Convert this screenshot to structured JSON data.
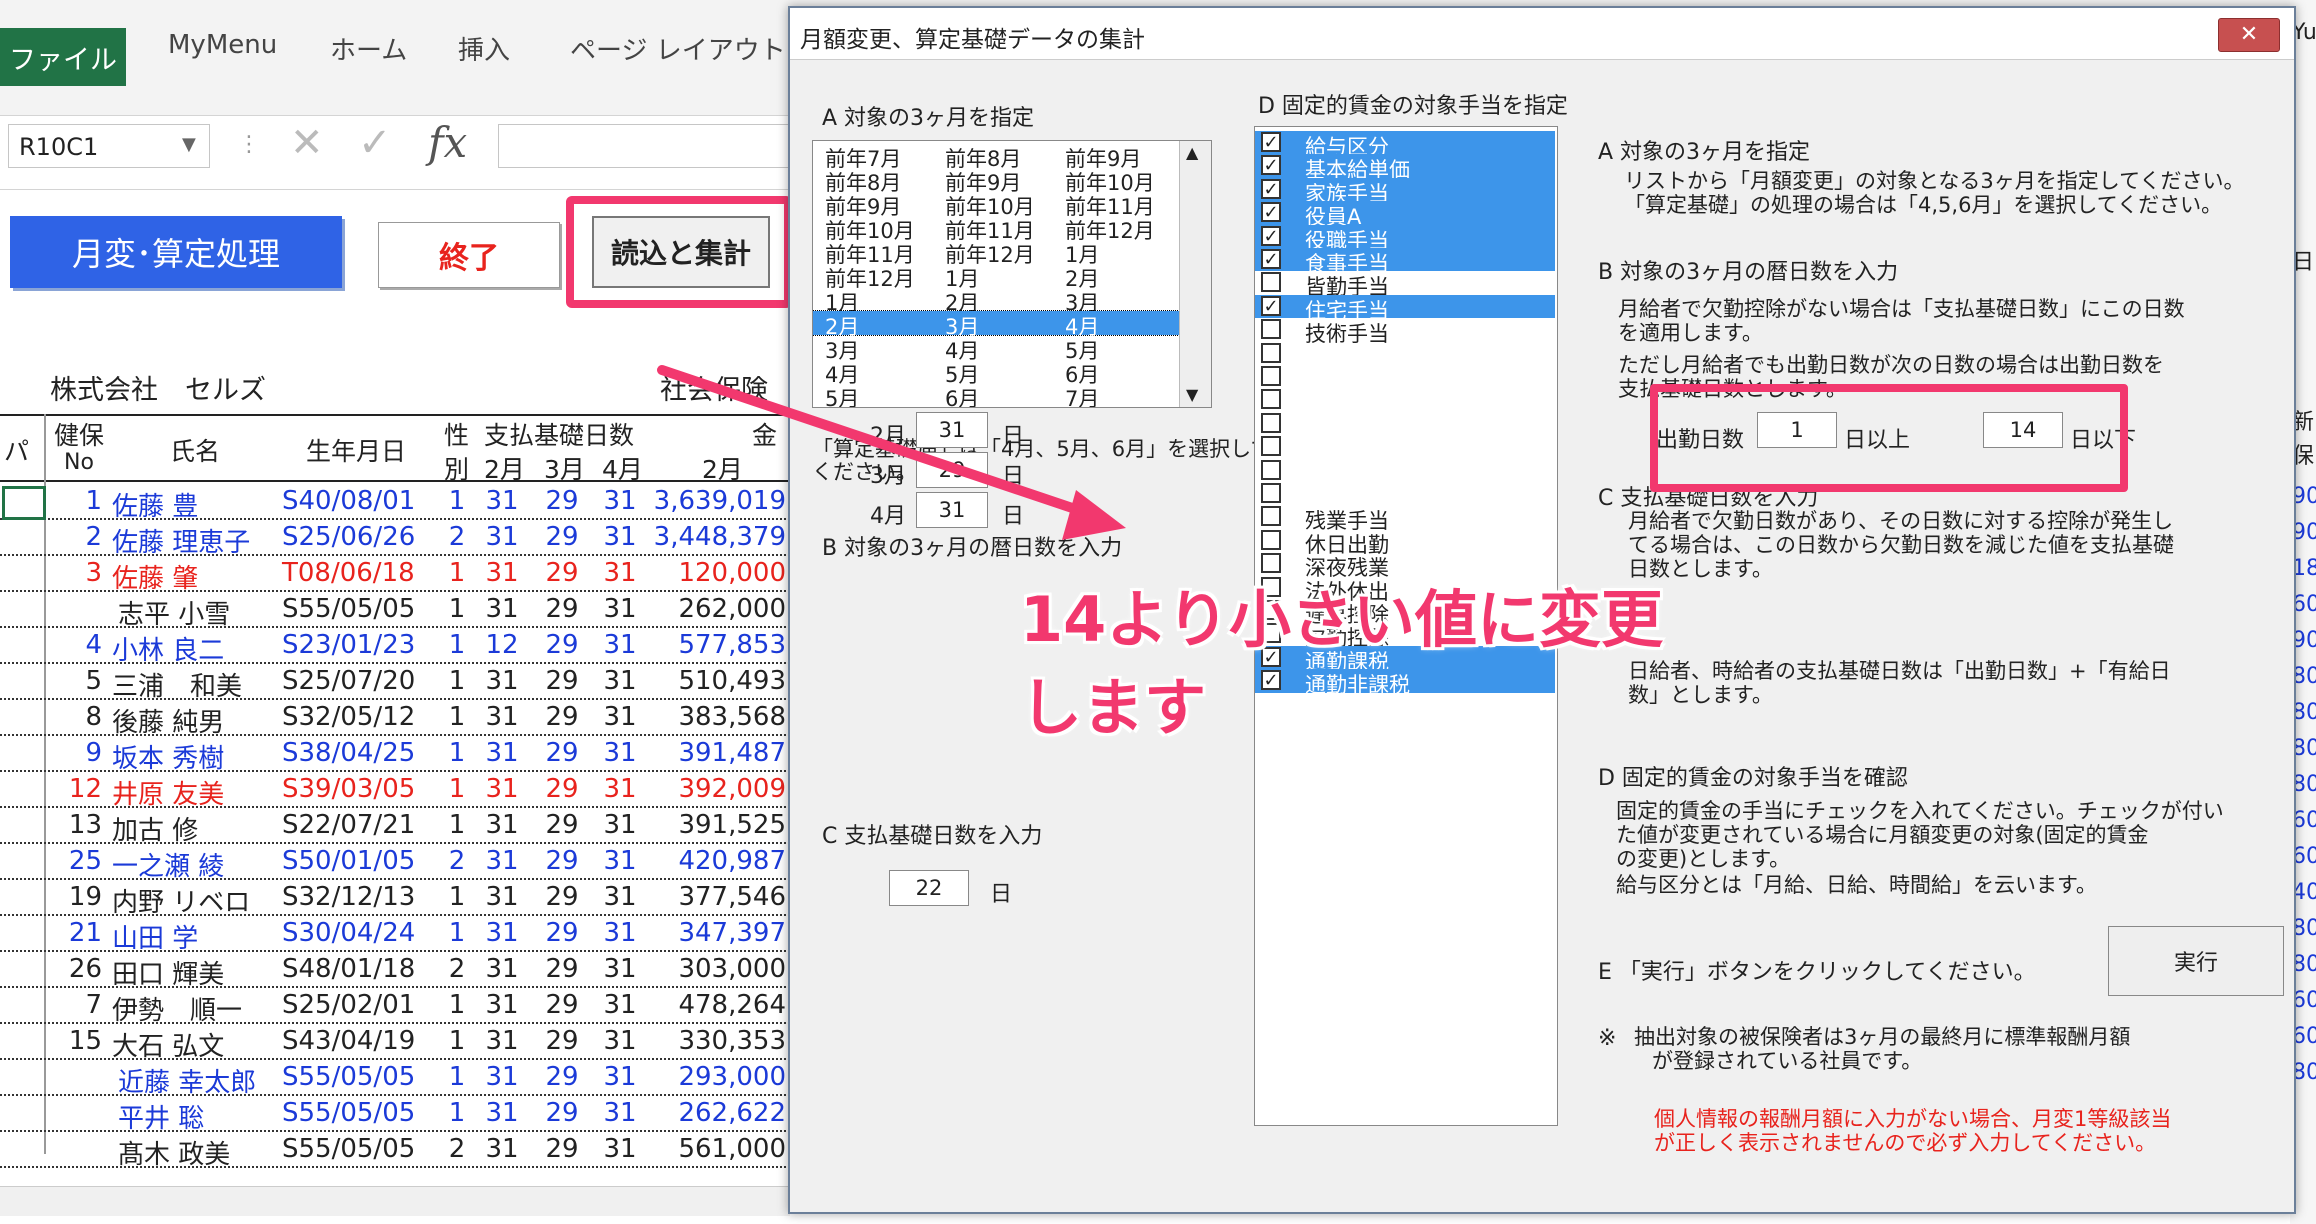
{
  "ribbon": {
    "tabs": [
      "ファイル",
      "MyMenu",
      "ホーム",
      "挿入",
      "ページ レイアウト"
    ]
  },
  "formula_bar": {
    "name_box": "R10C1",
    "fx": "fx"
  },
  "sheet": {
    "buttons": {
      "main": "月変･算定処理",
      "end": "終了",
      "read": "読込と集計"
    },
    "company": "株式会社　セルズ",
    "insurance_label": "社会保険",
    "headers": {
      "pa": "パ",
      "kenpo": "健保",
      "no": "No",
      "name": "氏名",
      "birth": "生年月日",
      "sex1": "性",
      "sex2": "別",
      "days_title": "支払基礎日数",
      "m2": "2月",
      "m3": "3月",
      "m4": "4月",
      "kin": "金",
      "amt2": "2月"
    },
    "rows": [
      {
        "no": "1",
        "name": "佐藤 豊",
        "birth": "S40/08/01",
        "sex": "1",
        "d2": "31",
        "d3": "29",
        "d4": "31",
        "amount": "3,639,019",
        "color": "#1b3ad8"
      },
      {
        "no": "2",
        "name": "佐藤 理恵子",
        "birth": "S25/06/26",
        "sex": "2",
        "d2": "31",
        "d3": "29",
        "d4": "31",
        "amount": "3,448,379",
        "color": "#1b3ad8"
      },
      {
        "no": "3",
        "name": "佐藤 肇",
        "birth": "T08/06/18",
        "sex": "1",
        "d2": "31",
        "d3": "29",
        "d4": "31",
        "amount": "120,000",
        "color": "#e8231d"
      },
      {
        "no": "",
        "name": "志平 小雪",
        "birth": "S55/05/05",
        "sex": "1",
        "d2": "31",
        "d3": "29",
        "d4": "31",
        "amount": "262,000",
        "color": "#222222"
      },
      {
        "no": "4",
        "name": "小林 良二",
        "birth": "S23/01/23",
        "sex": "1",
        "d2": "12",
        "d3": "29",
        "d4": "31",
        "amount": "577,853",
        "color": "#1b3ad8"
      },
      {
        "no": "5",
        "name": "三浦　和美",
        "birth": "S25/07/20",
        "sex": "1",
        "d2": "31",
        "d3": "29",
        "d4": "31",
        "amount": "510,493",
        "color": "#222222"
      },
      {
        "no": "8",
        "name": "後藤 純男",
        "birth": "S32/05/12",
        "sex": "1",
        "d2": "31",
        "d3": "29",
        "d4": "31",
        "amount": "383,568",
        "color": "#222222"
      },
      {
        "no": "9",
        "name": "坂本 秀樹",
        "birth": "S38/04/25",
        "sex": "1",
        "d2": "31",
        "d3": "29",
        "d4": "31",
        "amount": "391,487",
        "color": "#1b3ad8"
      },
      {
        "no": "12",
        "name": "井原 友美",
        "birth": "S39/03/05",
        "sex": "1",
        "d2": "31",
        "d3": "29",
        "d4": "31",
        "amount": "392,009",
        "color": "#e8231d"
      },
      {
        "no": "13",
        "name": "加古 修",
        "birth": "S22/07/21",
        "sex": "1",
        "d2": "31",
        "d3": "29",
        "d4": "31",
        "amount": "391,525",
        "color": "#222222"
      },
      {
        "no": "25",
        "name": "一之瀬 綾",
        "birth": "S50/01/05",
        "sex": "2",
        "d2": "31",
        "d3": "29",
        "d4": "31",
        "amount": "420,987",
        "color": "#1b3ad8"
      },
      {
        "no": "19",
        "name": "内野 リベロ",
        "birth": "S32/12/13",
        "sex": "1",
        "d2": "31",
        "d3": "29",
        "d4": "31",
        "amount": "377,546",
        "color": "#222222"
      },
      {
        "no": "21",
        "name": "山田 学",
        "birth": "S30/04/24",
        "sex": "1",
        "d2": "31",
        "d3": "29",
        "d4": "31",
        "amount": "347,397",
        "color": "#1b3ad8"
      },
      {
        "no": "26",
        "name": "田口 輝美",
        "birth": "S48/01/18",
        "sex": "2",
        "d2": "31",
        "d3": "29",
        "d4": "31",
        "amount": "303,000",
        "color": "#222222"
      },
      {
        "no": "7",
        "name": "伊勢　順一",
        "birth": "S25/02/01",
        "sex": "1",
        "d2": "31",
        "d3": "29",
        "d4": "31",
        "amount": "478,264",
        "color": "#222222"
      },
      {
        "no": "15",
        "name": "大石 弘文",
        "birth": "S43/04/19",
        "sex": "1",
        "d2": "31",
        "d3": "29",
        "d4": "31",
        "amount": "330,353",
        "color": "#222222"
      },
      {
        "no": "",
        "name": "近藤 幸太郎",
        "birth": "S55/05/05",
        "sex": "1",
        "d2": "31",
        "d3": "29",
        "d4": "31",
        "amount": "293,000",
        "color": "#1b3ad8"
      },
      {
        "no": "",
        "name": "平井 聡",
        "birth": "S55/05/05",
        "sex": "1",
        "d2": "31",
        "d3": "29",
        "d4": "31",
        "amount": "262,622",
        "color": "#1b3ad8"
      },
      {
        "no": "",
        "name": "髙木 政美",
        "birth": "S55/05/05",
        "sex": "2",
        "d2": "31",
        "d3": "29",
        "d4": "31",
        "amount": "561,000",
        "color": "#222222"
      }
    ],
    "right_edge": [
      "Yu",
      "日",
      "新",
      "保",
      "90",
      "90",
      "18",
      "60",
      "90",
      "80",
      "80",
      "80",
      "80",
      "60",
      "60",
      "40",
      "80",
      "80",
      "60",
      "60",
      "80"
    ]
  },
  "dialog": {
    "title": "月額変更、算定基礎データの集計",
    "close": "✕",
    "sec_a_label": "A 対象の3ヶ月を指定",
    "months": [
      [
        "前年7月",
        "前年8月",
        "前年9月"
      ],
      [
        "前年8月",
        "前年9月",
        "前年10月"
      ],
      [
        "前年9月",
        "前年10月",
        "前年11月"
      ],
      [
        "前年10月",
        "前年11月",
        "前年12月"
      ],
      [
        "前年11月",
        "前年12月",
        "1月"
      ],
      [
        "前年12月",
        "1月",
        "2月"
      ],
      [
        "1月",
        "2月",
        "3月"
      ],
      [
        "2月",
        "3月",
        "4月"
      ],
      [
        "3月",
        "4月",
        "5月"
      ],
      [
        "4月",
        "5月",
        "6月"
      ],
      [
        "5月",
        "6月",
        "7月"
      ]
    ],
    "selected_month_index": 7,
    "note_a_left": "「算定基礎届」は「4月、5月、6月」を選択してください。",
    "sec_b_label": "B 対象の3ヶ月の暦日数を入力",
    "b_rows": [
      {
        "label": "2月",
        "value": "31",
        "unit": "日"
      },
      {
        "label": "3月",
        "value": "29",
        "unit": "日"
      },
      {
        "label": "4月",
        "value": "31",
        "unit": "日"
      }
    ],
    "sec_c_label": "C 支払基礎日数を入力",
    "c_value": "22",
    "c_unit": "日",
    "sec_d_label": "D 固定的賃金の対象手当を指定",
    "allowances": [
      {
        "text": "給与区分",
        "checked": true,
        "selected": true
      },
      {
        "text": "基本給単価",
        "checked": true,
        "selected": true
      },
      {
        "text": "家族手当",
        "checked": true,
        "selected": true
      },
      {
        "text": "役員A",
        "checked": true,
        "selected": true
      },
      {
        "text": "役職手当",
        "checked": true,
        "selected": true
      },
      {
        "text": "食事手当",
        "checked": true,
        "selected": true
      },
      {
        "text": "皆勤手当",
        "checked": false,
        "selected": false
      },
      {
        "text": "住宅手当",
        "checked": true,
        "selected": true
      },
      {
        "text": "技術手当",
        "checked": false,
        "selected": false
      },
      {
        "text": "",
        "checked": false,
        "selected": false
      },
      {
        "text": "",
        "checked": false,
        "selected": false
      },
      {
        "text": "",
        "checked": false,
        "selected": false
      },
      {
        "text": "",
        "checked": false,
        "selected": false
      },
      {
        "text": "",
        "checked": false,
        "selected": false
      },
      {
        "text": "",
        "checked": false,
        "selected": false
      },
      {
        "text": "",
        "checked": false,
        "selected": false
      },
      {
        "text": "残業手当",
        "checked": false,
        "selected": false
      },
      {
        "text": "休日出勤",
        "checked": false,
        "selected": false
      },
      {
        "text": "深夜残業",
        "checked": false,
        "selected": false
      },
      {
        "text": "法外休出",
        "checked": false,
        "selected": false
      },
      {
        "text": "遅早控除",
        "checked": false,
        "selected": false
      },
      {
        "text": "欠勤控除",
        "checked": false,
        "selected": false
      },
      {
        "text": "通勤課税",
        "checked": true,
        "selected": true
      },
      {
        "text": "通勤非課税",
        "checked": true,
        "selected": true
      }
    ],
    "right": {
      "a_title": "A 対象の3ヶ月を指定",
      "a_note1": "リストから「月額変更」の対象となる3ヶ月を指定してください。",
      "a_note2": "「算定基礎」の処理の場合は「4,5,6月」を選択してください。",
      "b_title": "B 対象の3ヶ月の暦日数を入力",
      "b_note1": "月給者で欠勤控除がない場合は「支払基礎日数」にこの日数",
      "b_note2": "を適用します。",
      "b_note3": "ただし月給者でも出勤日数が次の日数の場合は出勤日数を",
      "b_note4": "支払基礎日数とします。",
      "days_label": "出勤日数",
      "days_from": "1",
      "days_from_unit": "日以上",
      "days_to": "14",
      "days_to_unit": "日以下",
      "c_title": "C 支払基礎日数を入力",
      "c_note1": "月給者で欠勤日数があり、その日数に対する控除が発生し",
      "c_note2": "てる場合は、この日数から欠勤日数を減じた値を支払基礎",
      "c_note3": "日数とします。",
      "c_note4": "日給者、時給者の支払基礎日数は「出勤日数」+「有給日",
      "c_note5": "数」とします。",
      "d_title": "D 固定的賃金の対象手当を確認",
      "d_note1": "固定的賃金の手当にチェックを入れてください。チェックが付い",
      "d_note2": "た値が変更されている場合に月額変更の対象(固定的賃金",
      "d_note3": "の変更)とします。",
      "d_note4": "給与区分とは「月給、日給、時間給」を云います。",
      "e_title": "E 「実行」ボタンをクリックしてください。",
      "exec": "実行",
      "asterisk": "※",
      "note_ast1": "抽出対象の被保険者は3ヶ月の最終月に標準報酬月額",
      "note_ast2": "が登録されている社員です。",
      "red1": "個人情報の報酬月額に入力がない場合、月変1等級該当",
      "red2": "が正しく表示されませんので必ず入力してください。"
    }
  },
  "annotation": {
    "line1": "14より小さい値に変更",
    "line2": "します"
  },
  "colors": {
    "accent": "#f2386e",
    "excel_green": "#217346",
    "selection_blue": "#3d95ea",
    "link_blue": "#1b3ad8",
    "red": "#e8231d"
  }
}
